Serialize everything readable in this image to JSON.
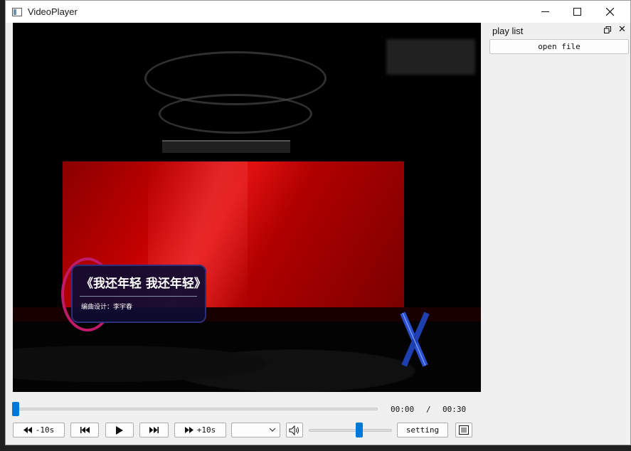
{
  "window": {
    "title": "VideoPlayer"
  },
  "title_buttons": {
    "minimize": "—",
    "maximize": "☐",
    "close": "✕"
  },
  "video": {
    "caption_title": "《我还年轻 我还年轻》",
    "caption_sub": "编曲设计：李宇春"
  },
  "player": {
    "current_time": "00:00",
    "separator": "/",
    "total_time": "00:30",
    "progress": 0.0,
    "volume": 0.62,
    "rewind_label": "-10s",
    "forward_label": "+10s",
    "setting_label": "setting",
    "speed_value": ""
  },
  "playlist": {
    "title": "play list",
    "open_file_label": "open file"
  },
  "colors": {
    "accent": "#0078d4",
    "window_bg": "#f0f0f0"
  },
  "icons": {
    "rewind": "rewind-icon",
    "previous": "skip-previous-icon",
    "play": "play-icon",
    "next": "skip-next-icon",
    "forward": "fast-forward-icon",
    "volume": "volume-icon",
    "playlist_toggle": "list-icon",
    "float": "float-icon",
    "close": "close-icon"
  }
}
